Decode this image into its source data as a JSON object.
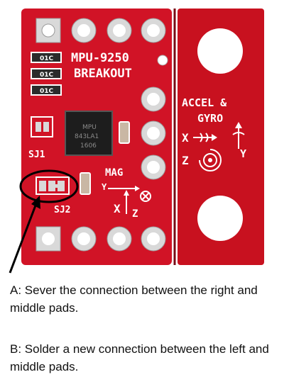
{
  "board": {
    "title_line1": "MPU-9250",
    "title_line2": "BREAKOUT",
    "accel_label": "ACCEL &",
    "gyro_label": "GYRO",
    "axis_x": "X",
    "axis_y": "Y",
    "axis_z": "Z",
    "mag_label": "MAG",
    "mag_axis_x": "X",
    "mag_axis_y": "Y",
    "mag_axis_z": "Z",
    "jumper_1": "SJ1",
    "jumper_2": "SJ2",
    "resistor_label": "01C",
    "chip_line1": "MPU",
    "chip_line2": "843LA1",
    "chip_line3": "1606",
    "pcb_color": "#d11326",
    "pad_color": "#d9d9d9",
    "callout_color": "#000000"
  },
  "instructions": {
    "a": "A: Sever the connection between the right and middle pads.",
    "b": "B: Solder a new connection between the left and middle pads."
  }
}
